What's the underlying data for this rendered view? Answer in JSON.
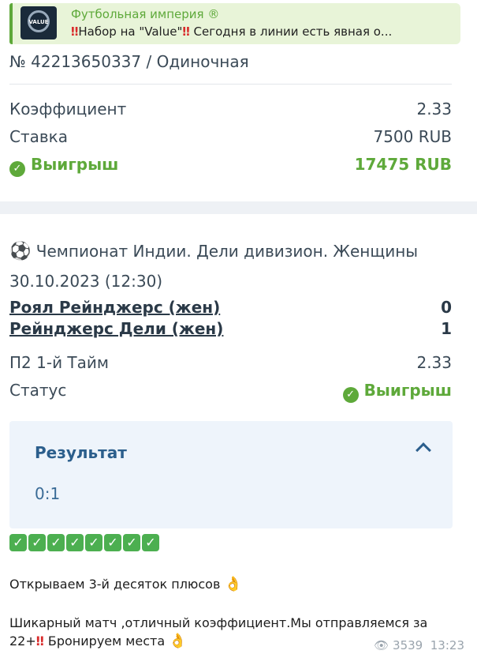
{
  "reply": {
    "channel_name": "Футбольная империя ®",
    "thumb_text": "VALUE",
    "snippet_pre": "Набор на \"Value\"",
    "snippet_post": " Сегодня в линии есть явная о..."
  },
  "bet": {
    "number": "№ 42213650337 / Одиночная",
    "coef_label": "Коэффициент",
    "coef_value": "2.33",
    "stake_label": "Ставка",
    "stake_value": "7500 RUB",
    "result_label": "Выигрыш",
    "result_value": "17475 RUB"
  },
  "event": {
    "league": "Чемпионат Индии. Дели дивизион. Женщины",
    "datetime": "30.10.2023 (12:30)",
    "team1": "Роял Рейнджерс (жен)",
    "score1": "0",
    "team2": "Рейнджерс Дели (жен)",
    "score2": "1",
    "market_label": "П2 1-й Тайм",
    "market_coef": "2.33",
    "status_label": "Статус",
    "status_value": "Выигрыш"
  },
  "result_panel": {
    "label": "Результат",
    "value": "0:1"
  },
  "checkmarks": [
    "✓",
    "✓",
    "✓",
    "✓",
    "✓",
    "✓",
    "✓",
    "✓"
  ],
  "message": {
    "line1": "Открываем 3-й десяток плюсов",
    "line2": "Шикарный матч ,отличный коэффициент.Мы отправляемся за",
    "line3_pre": "22+",
    "line3_post": " Бронируем места"
  },
  "meta": {
    "views": "3539",
    "time": "13:23"
  },
  "colors": {
    "accent_green": "#5ea93a",
    "bang_red": "#d92b2b",
    "link_blue": "#2b5e8c"
  }
}
